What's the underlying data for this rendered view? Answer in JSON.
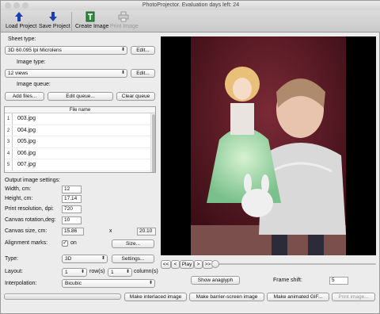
{
  "window": {
    "title": "PhotoProjector. Evaluation days left: 24"
  },
  "toolbar": {
    "load": "Load Project",
    "save": "Save Project",
    "create": "Create Image",
    "print": "Print Image"
  },
  "sheet": {
    "label": "Sheet type:",
    "value": "3D 60.095 lpi Microlens",
    "edit": "Edit..."
  },
  "image_type": {
    "label": "Image type:",
    "value": "12 views",
    "edit": "Edit..."
  },
  "queue": {
    "label": "Image queue:",
    "add": "Add files...",
    "edit": "Edit queue...",
    "clear": "Clear queue",
    "column": "File name",
    "rows": [
      {
        "n": "1",
        "file": "003.jpg"
      },
      {
        "n": "2",
        "file": "004.jpg"
      },
      {
        "n": "3",
        "file": "005.jpg"
      },
      {
        "n": "4",
        "file": "006.jpg"
      },
      {
        "n": "5",
        "file": "007.jpg"
      }
    ]
  },
  "output": {
    "heading": "Output image settings:",
    "width_label": "Width, cm:",
    "width": "12",
    "height_label": "Height, cm:",
    "height": "17.14",
    "dpi_label": "Print resolution, dpi:",
    "dpi": "720",
    "rotation_label": "Canvas rotation,deg:",
    "rotation": "10",
    "canvas_label": "Canvas size, cm:",
    "canvas_w": "15.86",
    "x": "x",
    "canvas_h": "20.10",
    "align_label": "Alignment marks:",
    "align_on": "on",
    "size_btn": "Size..."
  },
  "type": {
    "label": "Type:",
    "value": "3D",
    "settings": "Settings..."
  },
  "layout": {
    "label": "Layout:",
    "rows": "1",
    "rows_label": "row(s)",
    "cols": "1",
    "cols_label": "column(s)"
  },
  "interp": {
    "label": "Interpolation:",
    "value": "Bicubic"
  },
  "playback": {
    "first": "<<",
    "prev": "<",
    "play": "Play",
    "next": ">",
    "last": ">>",
    "position": 0.0
  },
  "anaglyph": {
    "label": "Show anaglyph"
  },
  "frame_shift": {
    "label": "Frame shift:",
    "value": "5"
  },
  "bottom": {
    "interlaced": "Make interlaced image",
    "barrier": "Make barrier-screen image",
    "gif": "Make animated GIF...",
    "print": "Print image..."
  },
  "colors": {
    "accent": "#1a3fb0",
    "preview_bg": "#000000",
    "backdrop": "#5a1a25"
  }
}
